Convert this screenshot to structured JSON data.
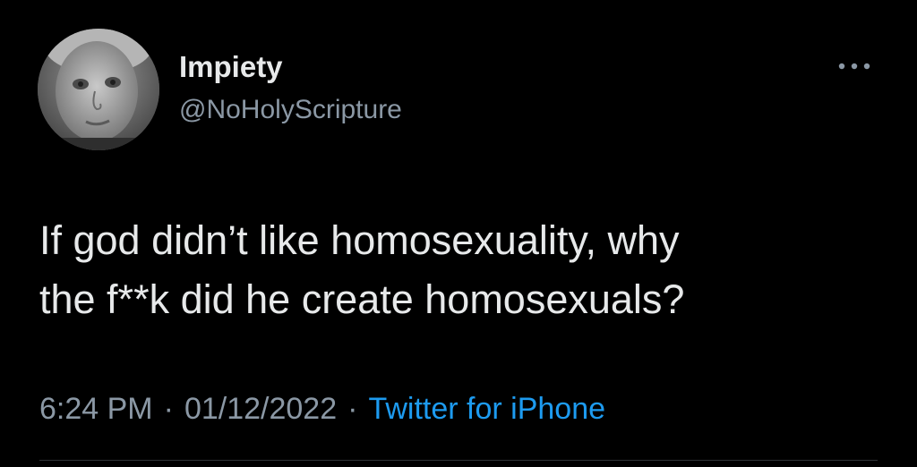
{
  "tweet": {
    "author": {
      "display_name": "Impiety",
      "handle": "@NoHolyScripture",
      "avatar_icon": "child-portrait-avatar"
    },
    "more_icon": "more-options-icon",
    "text_lines": [
      "If god didn’t like homosexuality, why",
      "the f**k did he create homosexuals?"
    ],
    "time": "6:24 PM",
    "separator": "·",
    "date": "01/12/2022",
    "source": "Twitter for iPhone"
  },
  "colors": {
    "background": "#000000",
    "primary_text": "#E7E9EA",
    "secondary_text": "#8B98A5",
    "accent": "#1D9BF0"
  }
}
